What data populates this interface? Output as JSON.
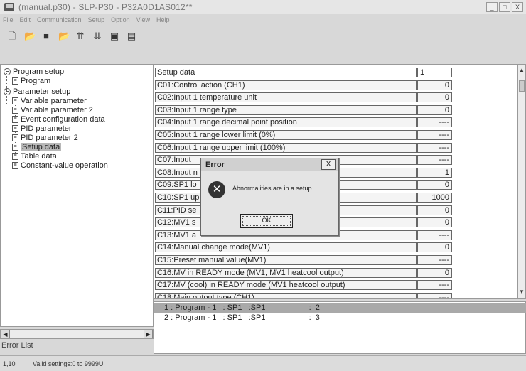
{
  "window": {
    "title": "(manual.p30) - SLP-P30 - P32A0D1AS012**",
    "buttons": [
      "_",
      "□",
      "X"
    ]
  },
  "menu": [
    "File",
    "Edit",
    "Communication",
    "Setup",
    "Option",
    "View",
    "Help"
  ],
  "toolbar": {
    "icons": [
      "new-file-icon",
      "open-folder-icon",
      "save-icon",
      "open-save-icon",
      "upload-icon",
      "download-icon",
      "monitor-icon",
      "screen-icon"
    ]
  },
  "tree": {
    "program_setup": "Program setup",
    "program": "Program",
    "parameter_setup": "Parameter setup",
    "items": [
      "Variable parameter",
      "Variable parameter 2",
      "Event configuration data",
      "PID parameter",
      "PID parameter 2",
      "Setup data",
      "Table data",
      "Constant-value operation"
    ],
    "error_list_label": "Error List"
  },
  "grid": {
    "header": {
      "name": "Setup data",
      "value": "1"
    },
    "rows": [
      {
        "name": "C01:Control action (CH1)",
        "value": "0"
      },
      {
        "name": "C02:Input 1 temperature unit",
        "value": "0"
      },
      {
        "name": "C03:Input 1 range type",
        "value": "0"
      },
      {
        "name": "C04:Input 1 range decimal point position",
        "value": "----"
      },
      {
        "name": "C05:Input 1 range lower limit (0%)",
        "value": "----"
      },
      {
        "name": "C06:Input 1 range upper limit (100%)",
        "value": "----"
      },
      {
        "name": "C07:Input",
        "value": "----"
      },
      {
        "name": "C08:Input                                           n",
        "value": "1"
      },
      {
        "name": "C09:SP1 lo",
        "value": "0"
      },
      {
        "name": "C10:SP1 up",
        "value": "1000"
      },
      {
        "name": "C11:PID se",
        "value": "0"
      },
      {
        "name": "C12:MV1 s",
        "value": "0"
      },
      {
        "name": "C13:MV1 a",
        "value": "----"
      },
      {
        "name": "C14:Manual change mode(MV1)",
        "value": "0"
      },
      {
        "name": "C15:Preset manual value(MV1)",
        "value": "----"
      },
      {
        "name": "C16:MV in READY mode (MV1, MV1 heatcool output)",
        "value": "0"
      },
      {
        "name": "C17:MV (cool) in READY mode (MV1 heatcool output)",
        "value": "----"
      },
      {
        "name": "C18:Main output type (CH1)",
        "value": "----"
      }
    ]
  },
  "program_list": [
    "1 : Program - 1   : SP1   :SP1                    :  2",
    "2 : Program - 1   : SP1   :SP1                    :  3"
  ],
  "status": {
    "position": "1,10",
    "message": "Valid settings:0 to 9999U"
  },
  "dialog": {
    "title": "Error",
    "close": "X",
    "message": "Abnormalities are in a setup",
    "ok": "OK"
  }
}
